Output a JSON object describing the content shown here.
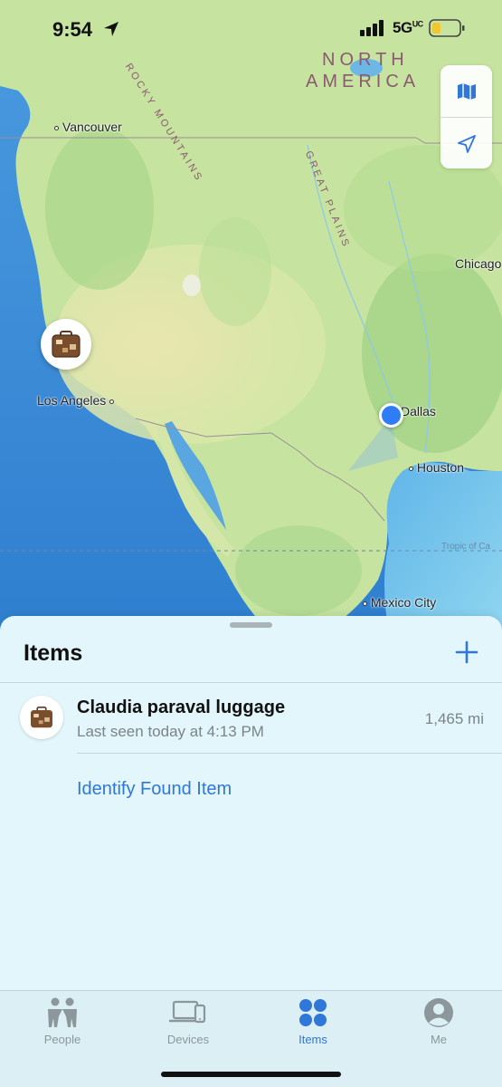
{
  "status_bar": {
    "time": "9:54",
    "network": "5G",
    "network_suffix": "UC"
  },
  "map": {
    "regions": {
      "north_america": [
        "NORTH",
        "AMERICA"
      ]
    },
    "ridges": {
      "rocky_mountains": "ROCKY MOUNTAINS",
      "great_plains": "GREAT PLAINS"
    },
    "cities": {
      "vancouver": "Vancouver",
      "los_angeles": "Los Angeles",
      "dallas": "Dallas",
      "houston": "Houston",
      "chicago": "Chicago",
      "mexico_city": "Mexico City"
    },
    "tropic": "Tropic of Ca",
    "controls": {
      "map_mode_icon": "map-icon",
      "location_icon": "location-arrow-icon"
    },
    "item_pin_icon": "luggage-icon"
  },
  "sheet": {
    "title": "Items",
    "add_icon": "plus-icon",
    "items": [
      {
        "name": "Claudia paraval luggage",
        "last_seen": "Last seen today at 4:13 PM",
        "distance": "1,465 mi",
        "icon": "luggage-icon"
      }
    ],
    "identify_link": "Identify Found Item"
  },
  "tabbar": {
    "tabs": [
      {
        "label": "People",
        "icon": "people-icon",
        "active": false
      },
      {
        "label": "Devices",
        "icon": "devices-icon",
        "active": false
      },
      {
        "label": "Items",
        "icon": "items-icon",
        "active": true
      },
      {
        "label": "Me",
        "icon": "person-icon",
        "active": false
      }
    ]
  },
  "colors": {
    "accent": "#2f77d8",
    "user_location": "#2f7df6",
    "sheet_bg": "#e2f6fb",
    "ocean": "#3b8fd9",
    "land": "#c9e4a6"
  }
}
